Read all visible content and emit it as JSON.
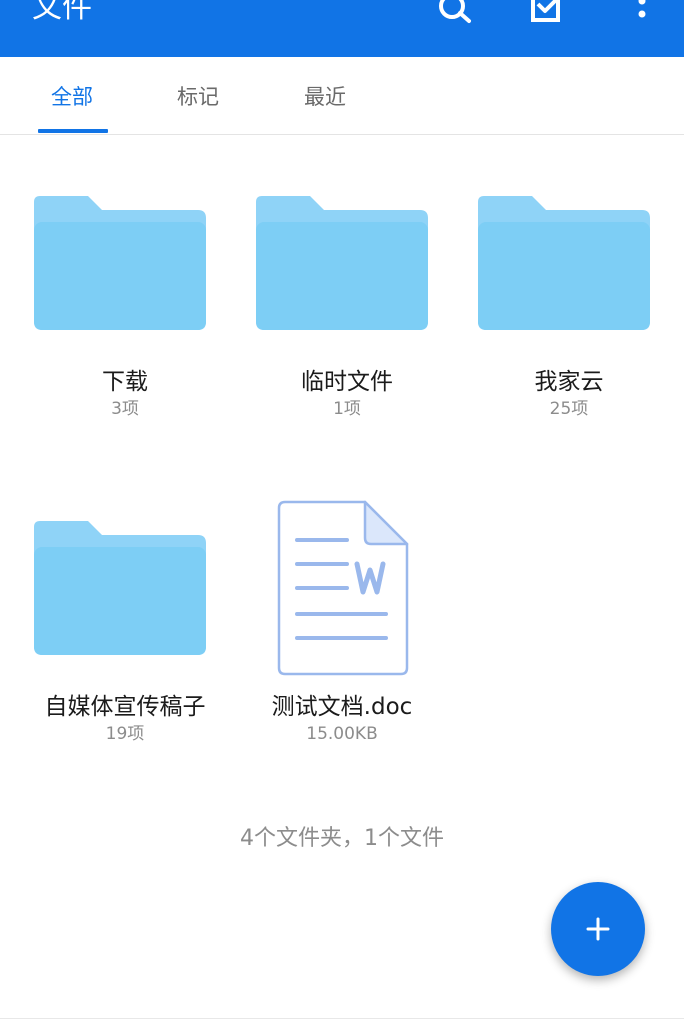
{
  "appbar": {
    "title": "文件",
    "icons": [
      "search-icon",
      "select-check-icon",
      "more-vert-icon"
    ]
  },
  "tabs": [
    {
      "label": "全部",
      "active": true
    },
    {
      "label": "标记",
      "active": false
    },
    {
      "label": "最近",
      "active": false
    }
  ],
  "items": [
    {
      "type": "folder",
      "name": "下载",
      "meta": "3项"
    },
    {
      "type": "folder",
      "name": "临时文件",
      "meta": "1项"
    },
    {
      "type": "folder",
      "name": "我家云",
      "meta": "25项"
    },
    {
      "type": "folder",
      "name": "自媒体宣传稿子",
      "meta": "19项"
    },
    {
      "type": "word-doc",
      "name": "测试文档.doc",
      "meta": "15.00KB"
    }
  ],
  "summary": "4个文件夹，1个文件",
  "fab": {
    "icon": "plus-icon"
  },
  "colors": {
    "primary": "#1174e6",
    "folder_back": "#8fd3f7",
    "folder_front": "#7dcef5",
    "doc_line": "#9ab8ec"
  }
}
